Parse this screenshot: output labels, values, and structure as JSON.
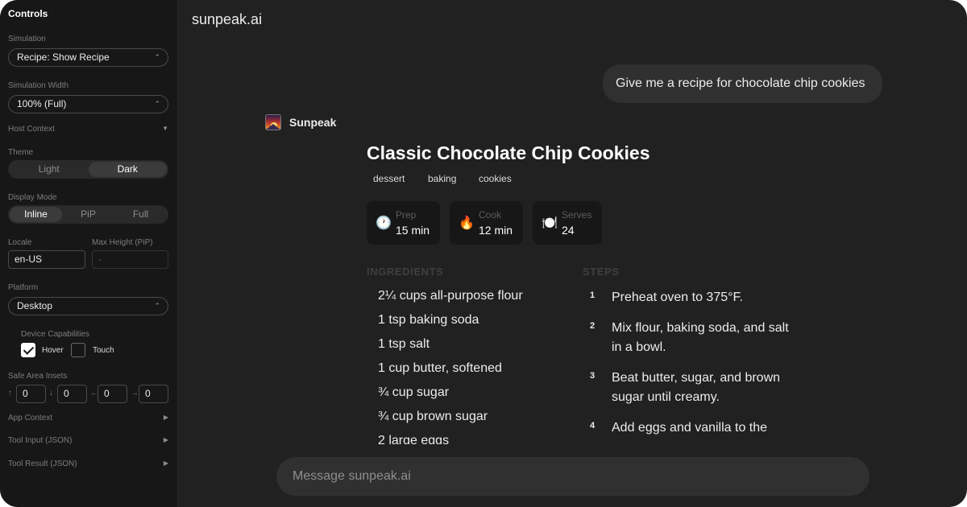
{
  "sidebar": {
    "title": "Controls",
    "simulation": {
      "label": "Simulation",
      "value": "Recipe: Show Recipe"
    },
    "simulation_width": {
      "label": "Simulation Width",
      "value": "100% (Full)"
    },
    "host_context": {
      "label": "Host Context",
      "arrow": "▼"
    },
    "theme": {
      "label": "Theme",
      "options": [
        "Light",
        "Dark"
      ],
      "selected": "Dark"
    },
    "display_mode": {
      "label": "Display Mode",
      "options": [
        "Inline",
        "PiP",
        "Full"
      ],
      "selected": "Inline"
    },
    "locale": {
      "label": "Locale",
      "value": "en-US"
    },
    "max_height": {
      "label": "Max Height (PiP)",
      "placeholder": "-"
    },
    "platform": {
      "label": "Platform",
      "value": "Desktop"
    },
    "device_capabilities": {
      "label": "Device Capabilities",
      "hover": {
        "label": "Hover",
        "checked": true
      },
      "touch": {
        "label": "Touch",
        "checked": false
      }
    },
    "safe_area": {
      "label": "Safe Area Insets",
      "insets": [
        {
          "arrow": "↑",
          "value": "0"
        },
        {
          "arrow": "↓",
          "value": "0"
        },
        {
          "arrow": "←",
          "value": "0"
        },
        {
          "arrow": "→",
          "value": "0"
        }
      ]
    },
    "collapsibles": [
      {
        "label": "App Context",
        "arrow": "▶"
      },
      {
        "label": "Tool Input (JSON)",
        "arrow": "▶"
      },
      {
        "label": "Tool Result (JSON)",
        "arrow": "▶"
      }
    ],
    "select_chevron": "⌃⌄"
  },
  "header": {
    "brand": "sunpeak.ai"
  },
  "conversation": {
    "user_message": "Give me a recipe for chocolate chip cookies",
    "assistant_name": "Sunpeak"
  },
  "recipe": {
    "title": "Classic Chocolate Chip Cookies",
    "tags": [
      "dessert",
      "baking",
      "cookies"
    ],
    "stats": [
      {
        "icon": "🕐",
        "label": "Prep",
        "value": "15 min"
      },
      {
        "icon": "🔥",
        "label": "Cook",
        "value": "12 min"
      },
      {
        "icon": "🍽️",
        "label": "Serves",
        "value": "24"
      }
    ],
    "ingredients_heading": "INGREDIENTS",
    "ingredients": [
      "2¼ cups all-purpose flour",
      "1 tsp baking soda",
      "1 tsp salt",
      "1 cup butter, softened",
      "¾ cup sugar",
      "¾ cup brown sugar",
      "2 large eggs"
    ],
    "steps_heading": "STEPS",
    "steps": [
      {
        "num": "1",
        "text": "Preheat oven to 375°F."
      },
      {
        "num": "2",
        "text": "Mix flour, baking soda, and salt in a bowl."
      },
      {
        "num": "3",
        "text": "Beat butter, sugar, and brown sugar until creamy."
      },
      {
        "num": "4",
        "text": "Add eggs and vanilla to the"
      }
    ]
  },
  "composer": {
    "placeholder": "Message sunpeak.ai"
  }
}
